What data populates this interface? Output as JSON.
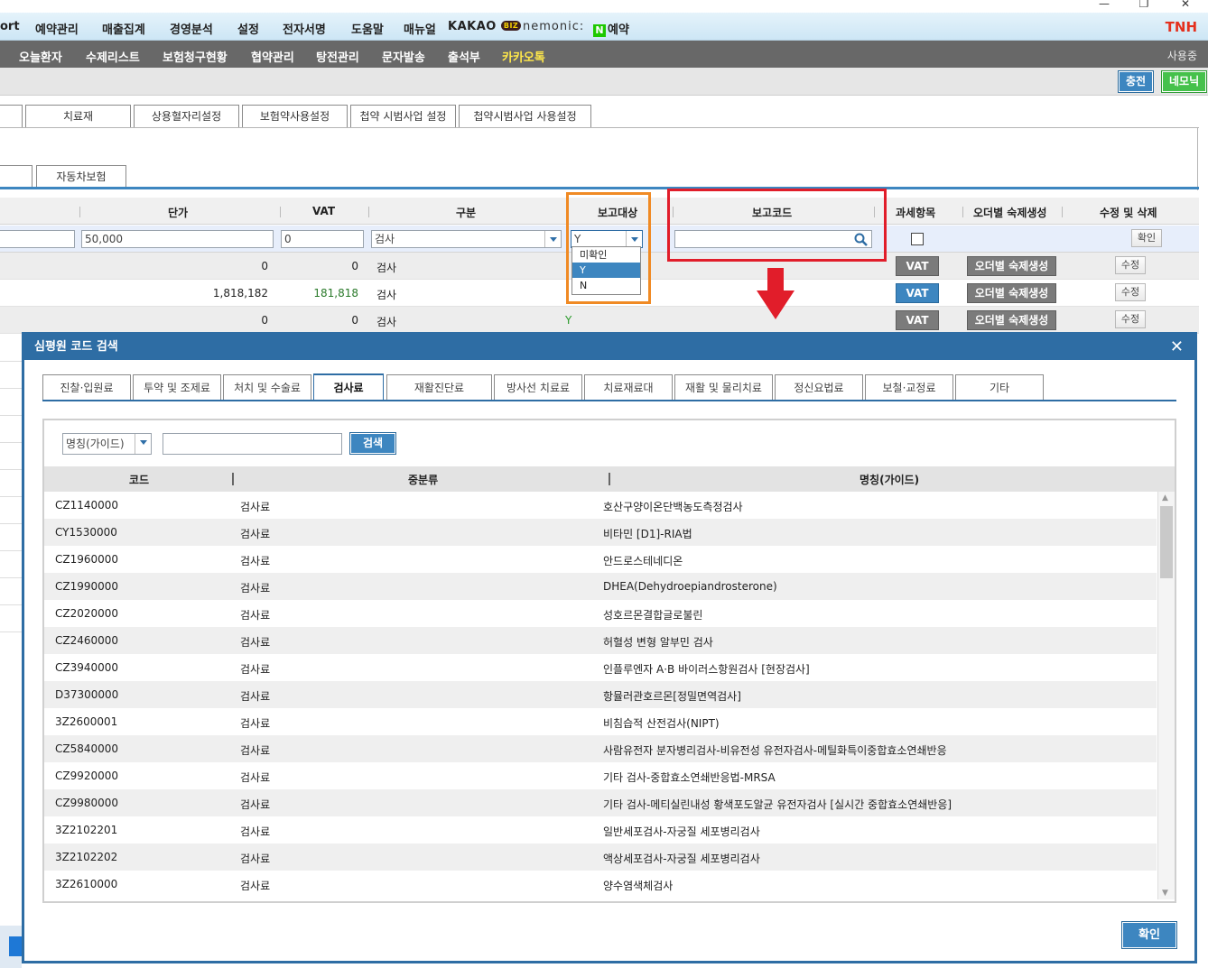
{
  "window": {
    "minimize": "—",
    "restore": "❐",
    "close": "✕"
  },
  "menubar": {
    "items": [
      "ort",
      "예약관리",
      "매출집계",
      "경영분석",
      "설정",
      "전자서명",
      "도움말",
      "매뉴얼"
    ],
    "kakao": "KAKAO",
    "biz": "BIZ",
    "nemonic": "nemonic:",
    "n_badge": "N",
    "reservation": "예약",
    "brand": "TNH"
  },
  "submenu": {
    "items": [
      "오늘환자",
      "수제리스트",
      "보험청구현황",
      "협약관리",
      "탕전관리",
      "문자발송",
      "출석부",
      "카카오톡"
    ],
    "user": "사용중"
  },
  "toolbar": {
    "charge": "충전",
    "nemonic": "네모닉"
  },
  "tabs_row1": [
    "치료재",
    "상용혈자리설정",
    "보험약사용설정",
    "첩약 시범사업 설정",
    "첩약시범사업 사용설정"
  ],
  "tabs_row2": [
    "자동차보험"
  ],
  "grid": {
    "headers": [
      "단가",
      "VAT",
      "구분",
      "보고대상",
      "보고코드",
      "과세항목",
      "오더별 숙제생성",
      "수정 및 삭제"
    ],
    "edit_row": {
      "price": "50,000",
      "vat": "0",
      "category": "검사",
      "report": "Y",
      "confirm": "확인"
    },
    "rows": [
      {
        "price": "0",
        "vat": "0",
        "category": "검사",
        "report": "",
        "vat_btn": "VAT",
        "order_btn": "오더별 숙제생성",
        "edit": "수정"
      },
      {
        "price": "1,818,182",
        "vat": "181,818",
        "category": "검사",
        "report": "",
        "vat_btn": "VAT",
        "order_btn": "오더별 숙제생성",
        "edit": "수정"
      },
      {
        "price": "0",
        "vat": "0",
        "category": "검사",
        "report": "Y",
        "vat_btn": "VAT",
        "order_btn": "오더별 숙제생성",
        "edit": "수정"
      }
    ],
    "dropdown_options": [
      "미확인",
      "Y",
      "N"
    ],
    "dropdown_selected": "Y"
  },
  "modal": {
    "title": "심평원 코드 검색",
    "close": "✕",
    "tabs": [
      "진찰·입원료",
      "투약 및 조제료",
      "처치 및 수술료",
      "검사료",
      "재활진단료",
      "방사선 치료료",
      "치료재료대",
      "재활 및 물리치료",
      "정신요법료",
      "보철·교정료",
      "기타"
    ],
    "active_tab": "검사료",
    "search_select": "명칭(가이드)",
    "search_value": "",
    "search_button": "검색",
    "columns": [
      "코드",
      "중분류",
      "명칭(가이드)"
    ],
    "rows": [
      {
        "code": "CZ1140000",
        "mid": "검사료",
        "name": "호산구양이온단백농도측정검사"
      },
      {
        "code": "CY1530000",
        "mid": "검사료",
        "name": "비타민 [D1]-RIA법"
      },
      {
        "code": "CZ1960000",
        "mid": "검사료",
        "name": "안드로스테네디온"
      },
      {
        "code": "CZ1990000",
        "mid": "검사료",
        "name": "DHEA(Dehydroepiandrosterone)"
      },
      {
        "code": "CZ2020000",
        "mid": "검사료",
        "name": "성호르몬결합글로불린"
      },
      {
        "code": "CZ2460000",
        "mid": "검사료",
        "name": "허혈성 변형 알부민 검사"
      },
      {
        "code": "CZ3940000",
        "mid": "검사료",
        "name": "인플루엔자 A·B 바이러스항원검사 [현장검사]"
      },
      {
        "code": "D37300000",
        "mid": "검사료",
        "name": "항뮬러관호르몬[정밀면역검사]"
      },
      {
        "code": "3Z2600001",
        "mid": "검사료",
        "name": "비침습적 산전검사(NIPT)"
      },
      {
        "code": "CZ5840000",
        "mid": "검사료",
        "name": "사람유전자 분자병리검사-비유전성 유전자검사-메틸화특이중합효소연쇄반응"
      },
      {
        "code": "CZ9920000",
        "mid": "검사료",
        "name": "기타 검사-중합효소연쇄반응법-MRSA"
      },
      {
        "code": "CZ9980000",
        "mid": "검사료",
        "name": "기타 검사-메티실린내성 황색포도알균 유전자검사 [실시간 중합효소연쇄반응]"
      },
      {
        "code": "3Z2102201",
        "mid": "검사료",
        "name": "일반세포검사-자궁질 세포병리검사"
      },
      {
        "code": "3Z2102202",
        "mid": "검사료",
        "name": "액상세포검사-자궁질 세포병리검사"
      },
      {
        "code": "3Z2610000",
        "mid": "검사료",
        "name": "양수염색체검사"
      }
    ],
    "ok": "확인"
  }
}
